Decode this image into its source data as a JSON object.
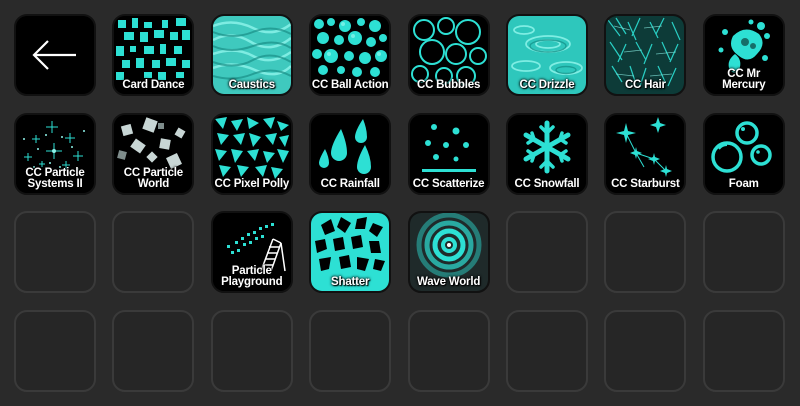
{
  "accent_color": "#2de0d4",
  "back_key": {
    "icon": "arrow-left-icon"
  },
  "keys": [
    {
      "label": "Card Dance",
      "icon": "card-dance-icon"
    },
    {
      "label": "Caustics",
      "icon": "caustics-icon"
    },
    {
      "label": "CC Ball Action",
      "icon": "ball-action-icon"
    },
    {
      "label": "CC Bubbles",
      "icon": "bubbles-icon"
    },
    {
      "label": "CC Drizzle",
      "icon": "drizzle-icon"
    },
    {
      "label": "CC Hair",
      "icon": "hair-icon"
    },
    {
      "label": "CC Mr Mercury",
      "icon": "mr-mercury-icon"
    },
    {
      "label": "CC Particle\nSystems II",
      "icon": "particle-systems-icon"
    },
    {
      "label": "CC Particle\nWorld",
      "icon": "particle-world-icon"
    },
    {
      "label": "CC Pixel Polly",
      "icon": "pixel-polly-icon"
    },
    {
      "label": "CC Rainfall",
      "icon": "rainfall-icon"
    },
    {
      "label": "CC Scatterize",
      "icon": "scatterize-icon"
    },
    {
      "label": "CC Snowfall",
      "icon": "snowflake-icon"
    },
    {
      "label": "CC Starburst",
      "icon": "starburst-icon"
    },
    {
      "label": "Foam",
      "icon": "foam-icon"
    },
    {
      "label": "Particle\nPlayground",
      "icon": "particle-playground-icon"
    },
    {
      "label": "Shatter",
      "icon": "shatter-icon"
    },
    {
      "label": "Wave World",
      "icon": "wave-world-icon"
    }
  ]
}
